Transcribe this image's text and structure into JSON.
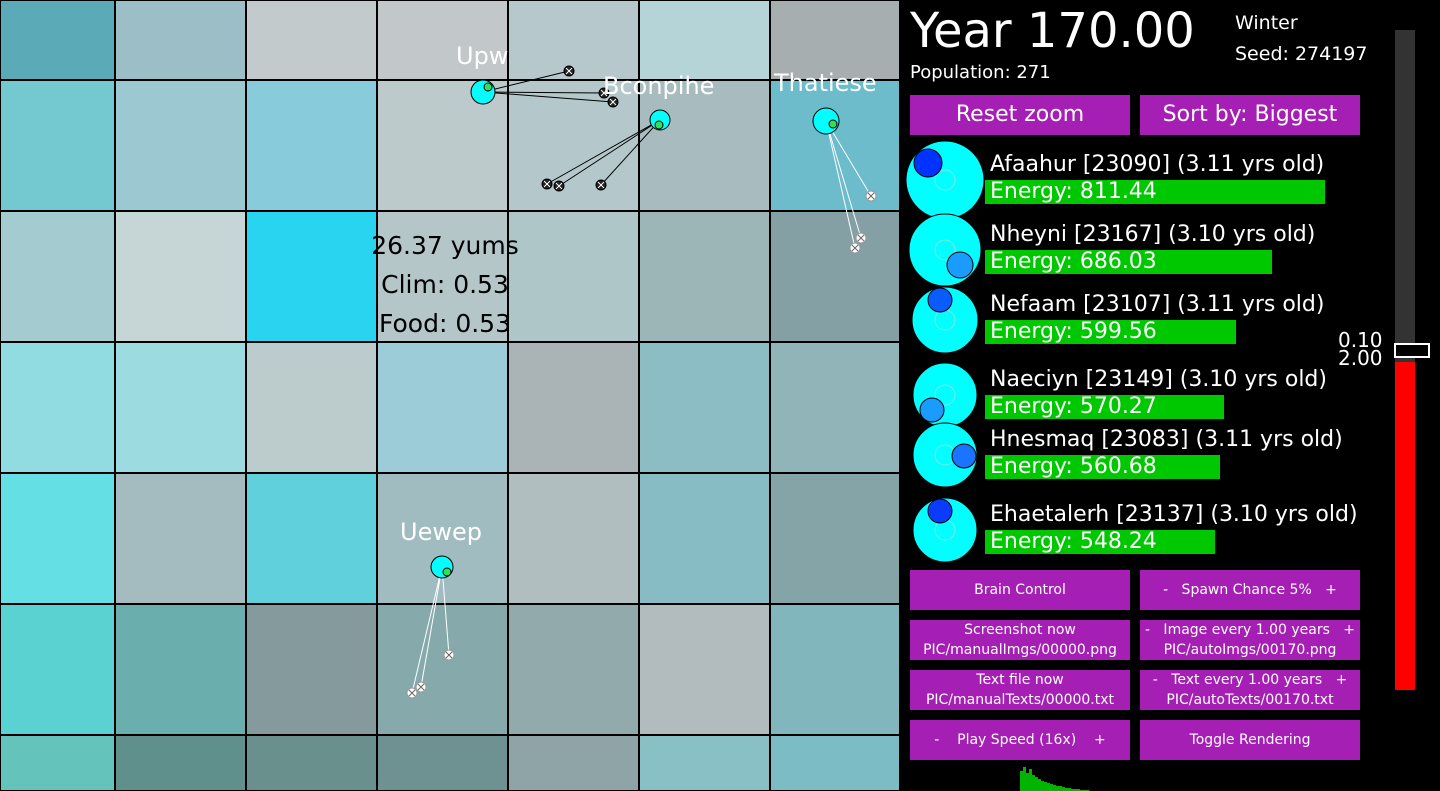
{
  "header": {
    "year": "Year 170.00",
    "season": "Winter",
    "seed": "Seed: 274197",
    "population": "Population: 271"
  },
  "buttons": {
    "reset_zoom": "Reset zoom",
    "sort_by": "Sort by: Biggest",
    "brain_control": "Brain Control",
    "spawn_chance": "-   Spawn Chance 5%   +",
    "screenshot_now": "Screenshot now",
    "screenshot_path": "PIC/manualImgs/00000.png",
    "image_every": "-   Image every 1.00 years   +",
    "image_path": "PIC/autoImgs/00170.png",
    "text_file_now": "Text file now",
    "text_file_path": "PIC/manualTexts/00000.txt",
    "text_every": "-   Text every 1.00 years   +",
    "text_path": "PIC/autoTexts/00170.txt",
    "play_speed": "-    Play Speed (16x)    +",
    "toggle_rendering": "Toggle Rendering"
  },
  "creatures_list": [
    {
      "name": "Afaahur [23090] (3.11 yrs old)",
      "energy": "Energy: 811.44",
      "energy_value": 811.44
    },
    {
      "name": "Nheyni [23167] (3.10 yrs old)",
      "energy": "Energy: 686.03",
      "energy_value": 686.03
    },
    {
      "name": "Nefaam [23107] (3.11 yrs old)",
      "energy": "Energy: 599.56",
      "energy_value": 599.56
    },
    {
      "name": "Naeciyn [23149] (3.10 yrs old)",
      "energy": "Energy: 570.27",
      "energy_value": 570.27
    },
    {
      "name": "Hnesmaq [23083] (3.11 yrs old)",
      "energy": "Energy: 560.68",
      "energy_value": 560.68
    },
    {
      "name": "Ehaetalerh [23137] (3.10 yrs old)",
      "energy": "Energy: 548.24",
      "energy_value": 548.24
    }
  ],
  "slider": {
    "label_top": "0.10",
    "label_bottom": "2.00"
  },
  "tile_info": {
    "yums": "26.37 yums",
    "clim": "Clim: 0.53",
    "food": "Food: 0.53"
  },
  "world_creatures": [
    {
      "name": "Upw"
    },
    {
      "name": "Bconpihe"
    },
    {
      "name": "Thatiese"
    },
    {
      "name": "Uewep"
    }
  ],
  "colors": {
    "button": "#a51fb4",
    "energy_bar": "#00c800",
    "creature": "#00ffff",
    "slider_red": "#ff0000",
    "slider_gray": "#333333"
  }
}
